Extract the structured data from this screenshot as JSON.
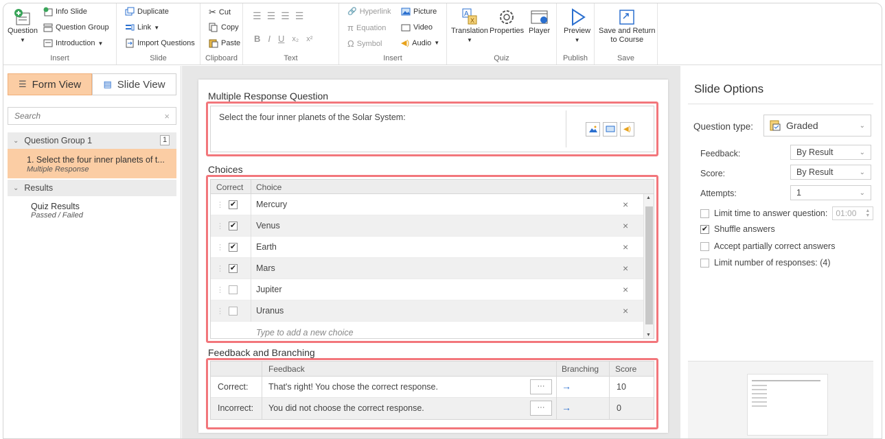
{
  "ribbon": {
    "insert_group": {
      "question": "Question",
      "info_slide": "Info Slide",
      "question_group": "Question Group",
      "introduction": "Introduction",
      "label": "Insert"
    },
    "slide_group": {
      "duplicate": "Duplicate",
      "link": "Link",
      "import_questions": "Import Questions",
      "label": "Slide"
    },
    "clipboard_group": {
      "cut": "Cut",
      "copy": "Copy",
      "paste": "Paste",
      "label": "Clipboard"
    },
    "text_group": {
      "label": "Text"
    },
    "insert2_group": {
      "hyperlink": "Hyperlink",
      "equation": "Equation",
      "symbol": "Symbol",
      "picture": "Picture",
      "video": "Video",
      "audio": "Audio",
      "label": "Insert"
    },
    "quiz_group": {
      "translation": "Translation",
      "properties": "Properties",
      "player": "Player",
      "label": "Quiz"
    },
    "publish_group": {
      "preview": "Preview",
      "label": "Publish"
    },
    "save_group": {
      "save_return_1": "Save and Return",
      "save_return_2": "to Course",
      "label": "Save"
    }
  },
  "left": {
    "form_view": "Form View",
    "slide_view": "Slide View",
    "search_placeholder": "Search",
    "group_name": "Question Group 1",
    "group_count": "1",
    "selected_item": "1. Select the four inner planets of t...",
    "selected_type": "Multiple Response",
    "results_header": "Results",
    "results_item": "Quiz Results",
    "results_sub": "Passed / Failed"
  },
  "center": {
    "question_heading": "Multiple Response Question",
    "question_text": "Select the four inner planets of the Solar System:",
    "choices_heading": "Choices",
    "col_correct": "Correct",
    "col_choice": "Choice",
    "choices": [
      {
        "text": "Mercury",
        "checked": true
      },
      {
        "text": "Venus",
        "checked": true
      },
      {
        "text": "Earth",
        "checked": true
      },
      {
        "text": "Mars",
        "checked": true
      },
      {
        "text": "Jupiter",
        "checked": false
      },
      {
        "text": "Uranus",
        "checked": false
      }
    ],
    "add_choice": "Type to add a new choice",
    "feedback_heading": "Feedback and Branching",
    "col_feedback": "Feedback",
    "col_branching": "Branching",
    "col_score": "Score",
    "correct_label": "Correct:",
    "correct_feedback": "That's right! You chose the correct response.",
    "correct_score": "10",
    "incorrect_label": "Incorrect:",
    "incorrect_feedback": "You did not choose the correct response.",
    "incorrect_score": "0",
    "dots": "···",
    "arrow": "→",
    "remove": "×"
  },
  "right": {
    "title": "Slide Options",
    "question_type_label": "Question type:",
    "question_type_value": "Graded",
    "feedback_label": "Feedback:",
    "feedback_value": "By Result",
    "score_label": "Score:",
    "score_value": "By Result",
    "attempts_label": "Attempts:",
    "attempts_value": "1",
    "limit_time": "Limit time to answer question:",
    "limit_time_value": "01:00",
    "shuffle": "Shuffle answers",
    "partial": "Accept partially correct answers",
    "limit_responses": "Limit number of responses: (4)"
  },
  "colors": {
    "highlight": "#f2767b",
    "accent_tab": "#fbcda4",
    "arrow": "#2a6fcf"
  }
}
